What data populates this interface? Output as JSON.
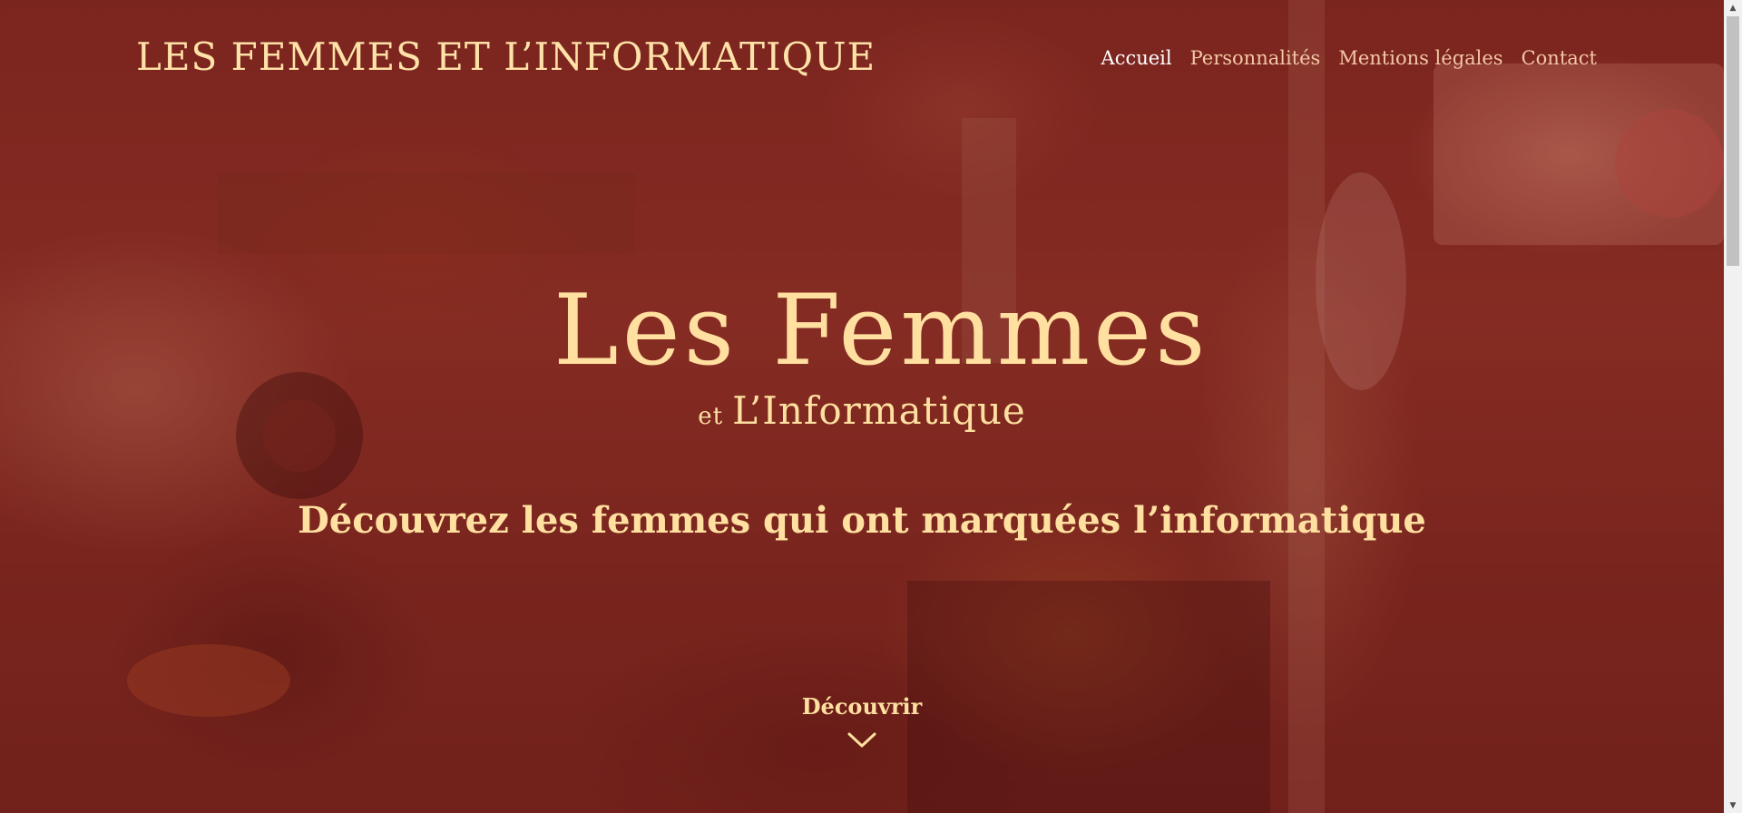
{
  "header": {
    "logo_text": "Les Femmes et L’Informatique"
  },
  "nav": {
    "items": [
      {
        "label": "Accueil",
        "active": true
      },
      {
        "label": "Personnalités",
        "active": false
      },
      {
        "label": "Mentions légales",
        "active": false
      },
      {
        "label": "Contact",
        "active": false
      }
    ]
  },
  "hero": {
    "logo_line1": "Les Femmes",
    "logo_et": "et",
    "logo_line2": "L’Informatique",
    "tagline": "Découvrez les femmes qui ont marquées l’informatique",
    "discover_label": "Découvrir"
  },
  "colors": {
    "accent_text": "#ffe0a0",
    "nav_text": "#f3c7a5",
    "background": "#8c3428"
  },
  "icons": {
    "discover": "chevron-down-icon",
    "scroll_up": "scroll-up-arrow-icon",
    "scroll_down": "scroll-down-arrow-icon"
  }
}
